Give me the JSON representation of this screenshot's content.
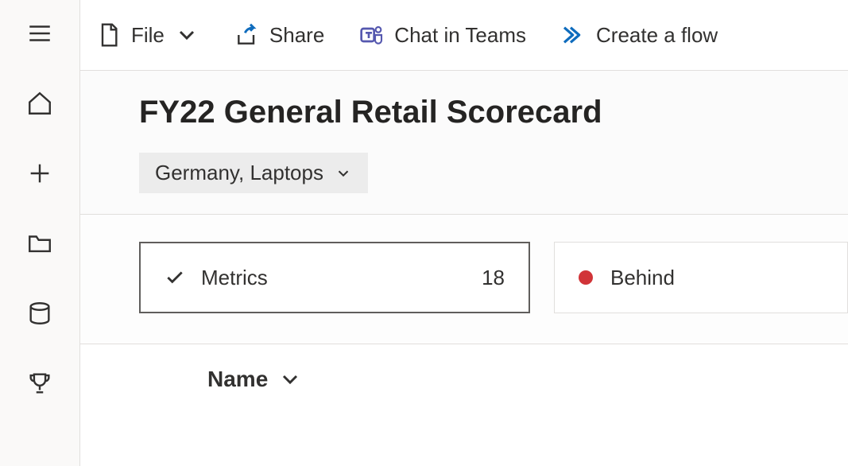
{
  "toolbar": {
    "file_label": "File",
    "share_label": "Share",
    "chat_label": "Chat in Teams",
    "flow_label": "Create a flow"
  },
  "header": {
    "title": "FY22 General Retail Scorecard",
    "filter_label": "Germany, Laptops"
  },
  "cards": {
    "metrics": {
      "label": "Metrics",
      "count": "18"
    },
    "behind": {
      "label": "Behind"
    }
  },
  "table": {
    "column_name": "Name"
  }
}
